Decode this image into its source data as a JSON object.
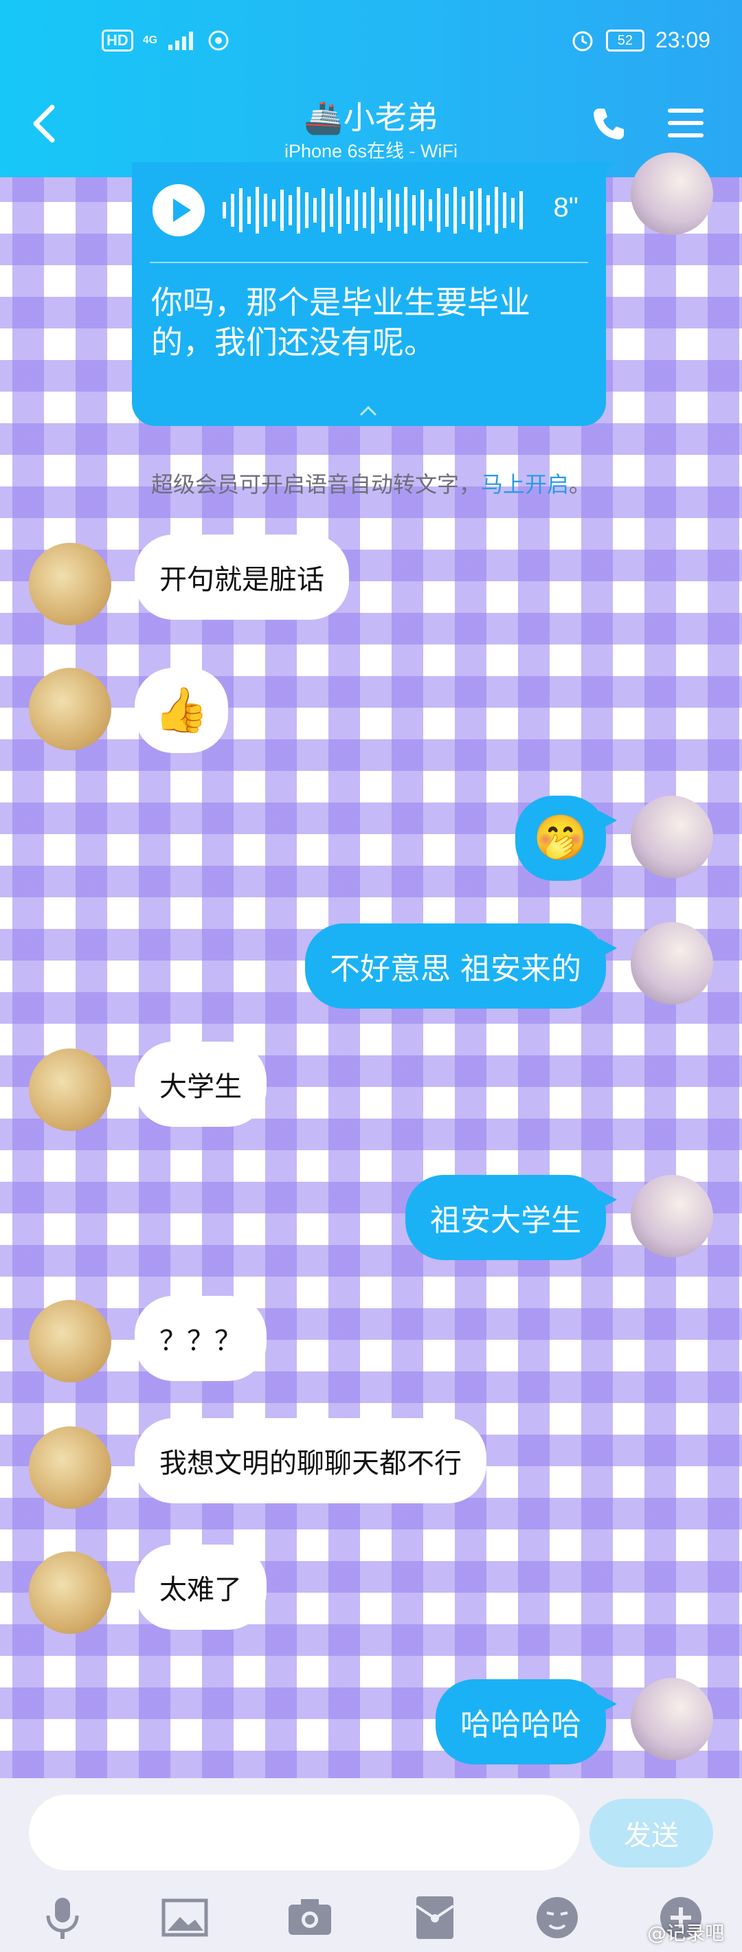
{
  "status_bar": {
    "network_hd": "HD",
    "network_type": "4G",
    "battery": "52",
    "time": "23:09"
  },
  "header": {
    "title": "🚢小老弟",
    "subtitle": "iPhone 6s在线 - WiFi"
  },
  "voice_message": {
    "duration": "8\"",
    "transcript": "你吗，那个是毕业生要毕业的，我们还没有呢。"
  },
  "notice": {
    "text": "超级会员可开启语音自动转文字，",
    "link": "马上开启",
    "end": "。"
  },
  "messages": [
    {
      "side": "in",
      "text": "开句就是脏话"
    },
    {
      "side": "in",
      "text": "👍"
    },
    {
      "side": "out",
      "text": "🤭"
    },
    {
      "side": "out",
      "text": "不好意思 祖安来的"
    },
    {
      "side": "in",
      "text": "大学生"
    },
    {
      "side": "out",
      "text": "祖安大学生"
    },
    {
      "side": "in",
      "text": "？？？"
    },
    {
      "side": "in",
      "text": "我想文明的聊聊天都不行"
    },
    {
      "side": "in",
      "text": "太难了"
    },
    {
      "side": "out",
      "text": "哈哈哈哈"
    }
  ],
  "input": {
    "value": "",
    "send_label": "发送"
  },
  "toolbar": [
    "microphone-icon",
    "image-icon",
    "camera-icon",
    "red-packet-icon",
    "emoji-icon",
    "plus-icon"
  ],
  "watermark": "@记录吧",
  "colors": {
    "header": "#1fbcf6",
    "outgoing_bubble": "#1ab2f5",
    "checker": "#9680f0"
  }
}
